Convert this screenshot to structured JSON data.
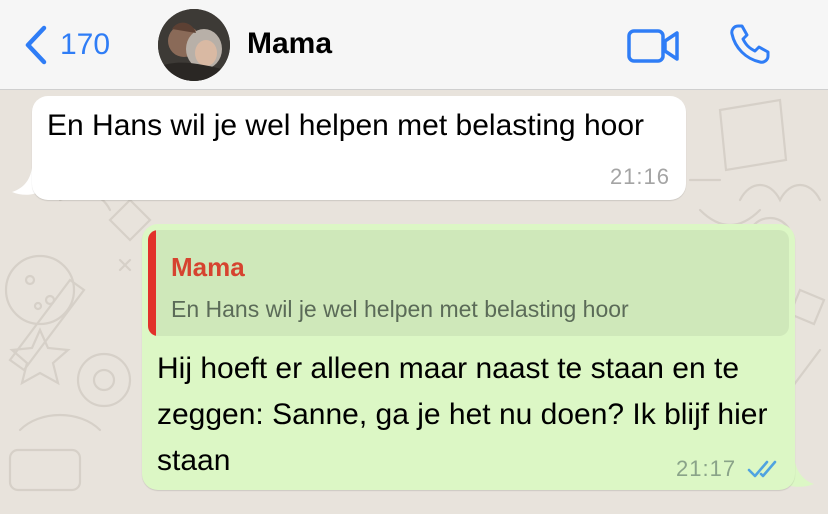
{
  "header": {
    "back_count": "170",
    "contact_name": "Mama",
    "icons": {
      "back": "chevron-left-icon",
      "video": "video-camera-icon",
      "call": "phone-icon"
    },
    "accent_color": "#2f7df6"
  },
  "messages": [
    {
      "direction": "incoming",
      "text": "En Hans wil je wel helpen met belasting hoor",
      "time": "21:16"
    },
    {
      "direction": "outgoing",
      "quote": {
        "author": "Mama",
        "text": "En Hans wil je wel helpen met belasting hoor"
      },
      "text": "Hij hoeft er alleen maar naast te staan en te zeggen: Sanne, ga je het nu doen? Ik blijf hier staan",
      "time": "21:17",
      "status": "read"
    }
  ],
  "colors": {
    "outgoing_bubble": "#dcf7c5",
    "incoming_bubble": "#ffffff",
    "quote_accent": "#e2312b",
    "read_ticks": "#4fa3e0"
  }
}
